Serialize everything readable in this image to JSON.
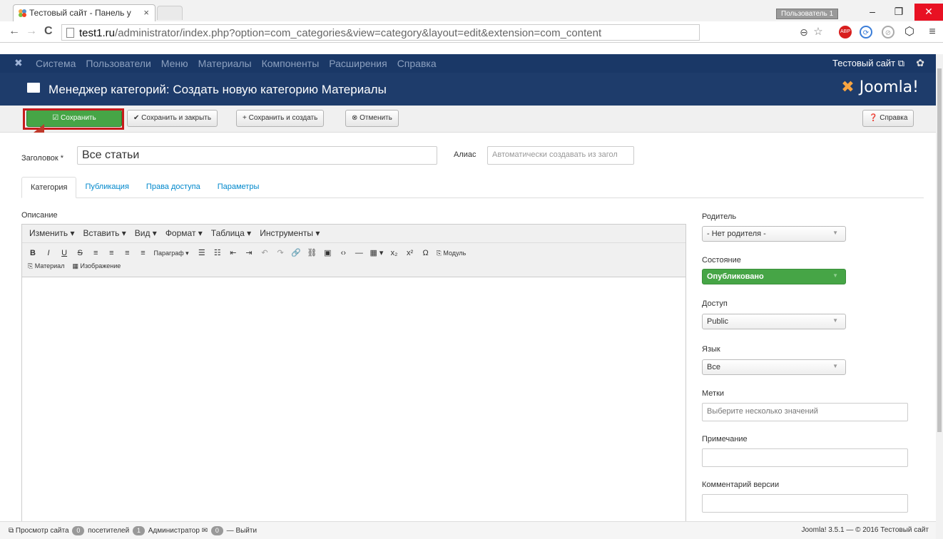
{
  "browser": {
    "tab_title": "Тестовый сайт - Панель у",
    "tab_close": "×",
    "user_chip": "Пользователь 1",
    "minimize": "–",
    "maximize": "❐",
    "close": "✕",
    "back": "←",
    "forward": "→",
    "reload": "C",
    "url_host": "test1.ru",
    "url_path": "/administrator/index.php?option=com_categories&view=category&layout=edit&extension=com_content",
    "ext_abp": "ABP",
    "menu_icon": "≡"
  },
  "topmenu": {
    "items": [
      "Система",
      "Пользователи",
      "Меню",
      "Материалы",
      "Компоненты",
      "Расширения",
      "Справка"
    ],
    "site_link": "Тестовый сайт ⧉",
    "gear": "✿"
  },
  "titlebar": {
    "title": "Менеджер категорий: Создать новую категорию Материалы",
    "brand": "Joomla!"
  },
  "toolbar": {
    "save": "☑ Сохранить",
    "save_close": "✔ Сохранить и закрыть",
    "save_new": "+ Сохранить и создать",
    "cancel": "⊗ Отменить",
    "help": "❓ Справка"
  },
  "form": {
    "title_label": "Заголовок *",
    "title_value": "Все статьи",
    "alias_label": "Алиас",
    "alias_placeholder": "Автоматически создавать из загол",
    "tabs": [
      "Категория",
      "Публикация",
      "Права доступа",
      "Параметры"
    ],
    "description_label": "Описание",
    "editor_menu": [
      "Изменить ▾",
      "Вставить ▾",
      "Вид ▾",
      "Формат ▾",
      "Таблица ▾",
      "Инструменты ▾"
    ],
    "editor_tools": [
      "B",
      "I",
      "U",
      "S",
      "≡",
      "≡",
      "≡",
      "≡"
    ],
    "format_select": "Параграф ▾",
    "editor_tools2": [
      "☰",
      "☷",
      "⇤",
      "⇥",
      "↶",
      "↷",
      "🔗",
      "⛓",
      "▣",
      "‹›",
      "—",
      "▦ ▾",
      "x₂",
      "x²",
      "Ω"
    ],
    "module_btn": "Модуль",
    "article_btn": "Материал",
    "image_btn": "Изображение"
  },
  "sidebar": {
    "parent_label": "Родитель",
    "parent_value": "- Нет родителя -",
    "state_label": "Состояние",
    "state_value": "Опубликовано",
    "access_label": "Доступ",
    "access_value": "Public",
    "language_label": "Язык",
    "language_value": "Все",
    "tags_label": "Метки",
    "tags_placeholder": "Выберите несколько значений",
    "note_label": "Примечание",
    "version_label": "Комментарий версии"
  },
  "statusbar": {
    "view_site": "Просмотр сайта",
    "visitors_count": "0",
    "visitors_label": "посетителей",
    "admins_count": "1",
    "admins_label": "Администратор",
    "messages_count": "0",
    "logout": "— Выйти",
    "version": "Joomla! 3.5.1 — © 2016 Тестовый сайт"
  },
  "colors": {
    "header_bg": "#1e3c6b",
    "save_green": "#46a546",
    "highlight_red": "#c71c1c"
  }
}
